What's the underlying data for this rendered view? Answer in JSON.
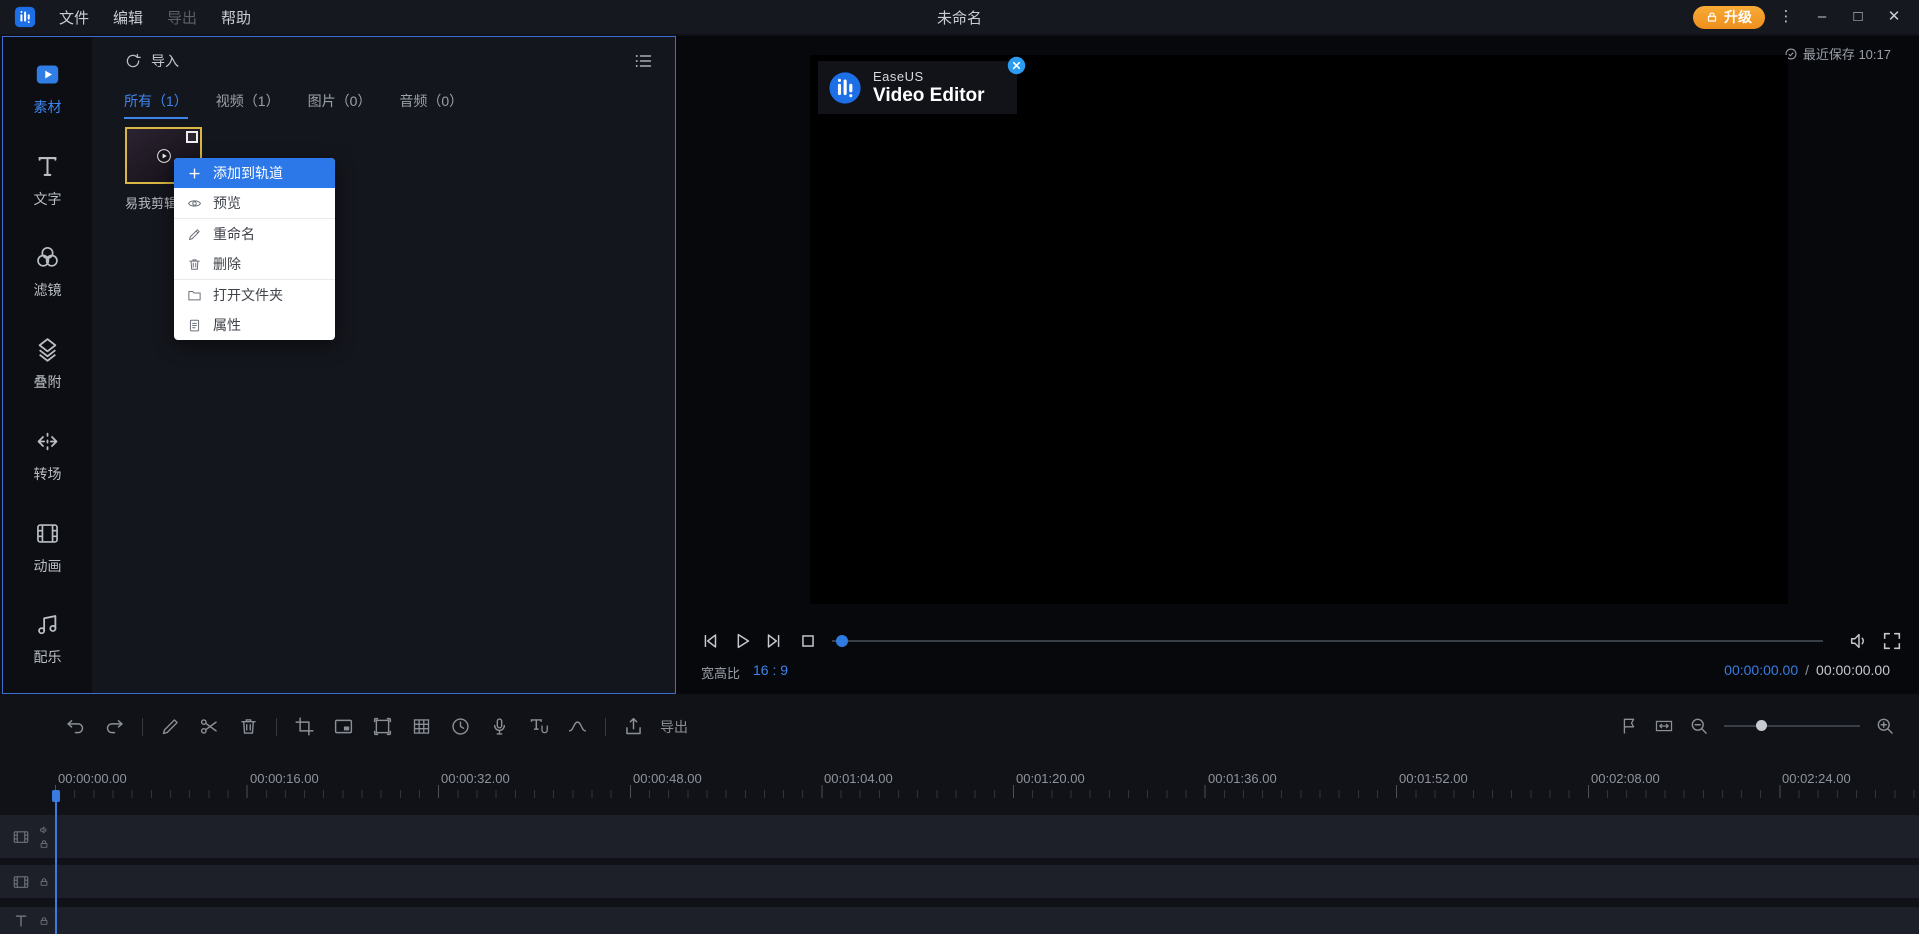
{
  "colors": {
    "accent_blue": "#3f84ec",
    "panel_border_blue": "#3d6fd3",
    "context_highlight_blue": "#2d78e8",
    "upgrade_orange": "#f29b2b",
    "selection_yellow": "#d8b742",
    "time_blue": "#3a7be0"
  },
  "titlebar": {
    "title": "未命名",
    "menus": [
      {
        "label": "文件"
      },
      {
        "label": "编辑"
      },
      {
        "label": "导出",
        "disabled": true
      },
      {
        "label": "帮助"
      }
    ],
    "upgrade_label": "升级",
    "window_icons": {
      "overflow": "⋮",
      "minimize": "–",
      "maximize": "□",
      "close": "✕"
    }
  },
  "sidebar": {
    "items": [
      {
        "label": "素材",
        "icon": "media-icon",
        "active": true
      },
      {
        "label": "文字",
        "icon": "text-icon"
      },
      {
        "label": "滤镜",
        "icon": "filter-icon"
      },
      {
        "label": "叠附",
        "icon": "overlay-icon"
      },
      {
        "label": "转场",
        "icon": "transition-icon"
      },
      {
        "label": "动画",
        "icon": "animation-icon"
      },
      {
        "label": "配乐",
        "icon": "music-icon"
      }
    ]
  },
  "media_panel": {
    "import_label": "导入",
    "tabs": [
      {
        "label": "所有（1）",
        "active": true
      },
      {
        "label": "视频（1）"
      },
      {
        "label": "图片（0）"
      },
      {
        "label": "音频（0）"
      }
    ],
    "clip_name": "易我剪辑"
  },
  "context_menu": {
    "items": [
      {
        "label": "添加到轨道",
        "icon": "plus-icon",
        "highlighted": true
      },
      {
        "label": "预览",
        "icon": "eye-icon"
      },
      {
        "label": "重命名",
        "icon": "rename-icon"
      },
      {
        "label": "删除",
        "icon": "delete-icon"
      },
      {
        "label": "打开文件夹",
        "icon": "folder-icon"
      },
      {
        "label": "属性",
        "icon": "properties-icon"
      }
    ]
  },
  "preview": {
    "saved_status": "最近保存 10:17",
    "watermark_brand": "EaseUS",
    "watermark_product": "Video Editor",
    "aspect_label": "宽高比",
    "aspect_value": "16 : 9",
    "time_current": "00:00:00.00",
    "time_separator": "/",
    "time_total": "00:00:00.00"
  },
  "timeline": {
    "export_label": "导出",
    "ruler_labels": [
      "00:00:00.00",
      "00:00:16.00",
      "00:00:32.00",
      "00:00:48.00",
      "00:01:04.00",
      "00:01:20.00",
      "00:01:36.00",
      "00:01:52.00",
      "00:02:08.00",
      "00:02:24.00"
    ]
  }
}
